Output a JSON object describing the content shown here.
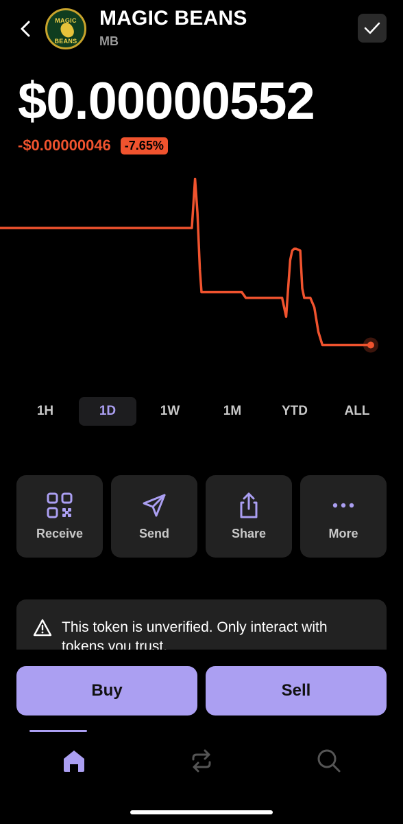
{
  "header": {
    "token_name": "MAGIC BEANS",
    "token_symbol": "MB",
    "logo_text_top": "MAGIC",
    "logo_text_bottom": "BEANS",
    "back_icon": "chevron-left-icon",
    "check_icon": "checkmark-icon"
  },
  "price": {
    "value": "$0.00000552",
    "change_abs": "-$0.00000046",
    "change_pct": "-7.65%"
  },
  "colors": {
    "accent": "#ab9ff2",
    "negative": "#f0532e",
    "surface": "#222222",
    "background": "#000000"
  },
  "chart_data": {
    "type": "line",
    "x": [
      0,
      0.2,
      0.4,
      0.476,
      0.484,
      0.49,
      0.496,
      0.5,
      0.51,
      0.52,
      0.54,
      0.58,
      0.6,
      0.61,
      0.66,
      0.7,
      0.71,
      0.715,
      0.72,
      0.725,
      0.73,
      0.735,
      0.745,
      0.75,
      0.755,
      0.76,
      0.77,
      0.78,
      0.79,
      0.8,
      0.815,
      0.83,
      0.92
    ],
    "series": [
      {
        "values": [
          0.72,
          0.72,
          0.72,
          0.72,
          0.98,
          0.8,
          0.5,
          0.38,
          0.38,
          0.38,
          0.38,
          0.38,
          0.38,
          0.35,
          0.35,
          0.35,
          0.25,
          0.4,
          0.55,
          0.6,
          0.61,
          0.61,
          0.6,
          0.4,
          0.35,
          0.35,
          0.35,
          0.3,
          0.17,
          0.1,
          0.1,
          0.1,
          0.1
        ]
      }
    ],
    "marker_last_point": true,
    "line_color": "#f0532e",
    "grid": false
  },
  "ranges": {
    "items": [
      "1H",
      "1D",
      "1W",
      "1M",
      "YTD",
      "ALL"
    ],
    "selected": "1D"
  },
  "actions": [
    {
      "label": "Receive",
      "icon": "qr-code-icon"
    },
    {
      "label": "Send",
      "icon": "send-icon"
    },
    {
      "label": "Share",
      "icon": "share-icon"
    },
    {
      "label": "More",
      "icon": "more-dots-icon"
    }
  ],
  "warning": {
    "icon": "warning-triangle-icon",
    "text": "This token is unverified. Only interact with tokens you trust."
  },
  "trade": {
    "buy_label": "Buy",
    "sell_label": "Sell"
  },
  "tabbar": {
    "tabs": [
      {
        "icon": "home-icon",
        "active": true
      },
      {
        "icon": "swap-icon",
        "active": false
      },
      {
        "icon": "search-icon",
        "active": false
      }
    ]
  }
}
